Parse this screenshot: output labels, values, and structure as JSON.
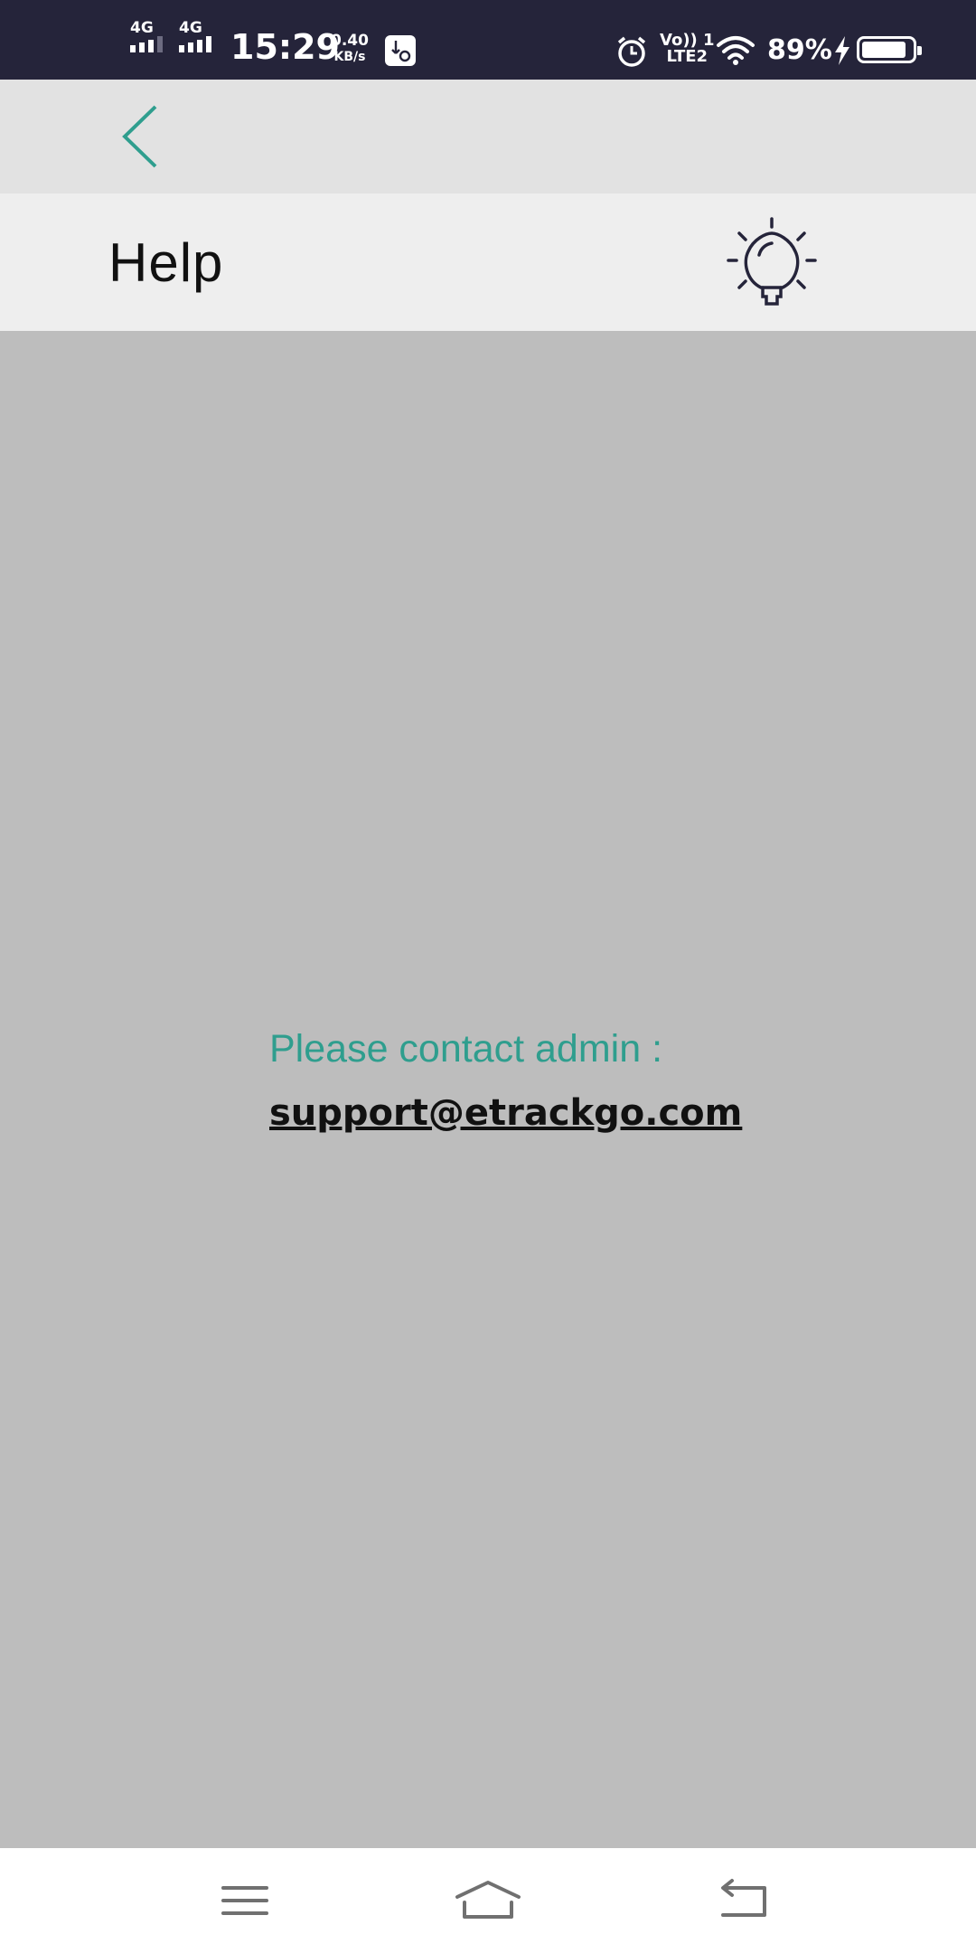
{
  "status_bar": {
    "network1": "4G",
    "network2": "4G",
    "time": "15:29",
    "speed_value": "0.40",
    "speed_unit": "KB/s",
    "volte_top": "Vo)) 1",
    "volte_bottom": "LTE2",
    "battery_percent": "89%",
    "battery_level": 0.89,
    "icons": [
      "usb-debug-icon",
      "alarm-icon",
      "wifi-icon",
      "charging-icon",
      "battery-icon"
    ]
  },
  "nav": {
    "back_icon": "chevron-left-icon"
  },
  "header": {
    "title": "Help",
    "icon": "lightbulb-icon"
  },
  "main": {
    "contact_label": "Please contact admin :",
    "contact_email": "support@etrackgo.com"
  },
  "system_nav": {
    "icons": [
      "menu-icon",
      "home-icon",
      "back-icon"
    ]
  },
  "colors": {
    "status_bar_bg": "#25243a",
    "accent": "#2f9e8e",
    "nav_bg": "#e2e2e2",
    "title_bg": "#eeeeee",
    "content_bg": "#bdbdbd"
  }
}
